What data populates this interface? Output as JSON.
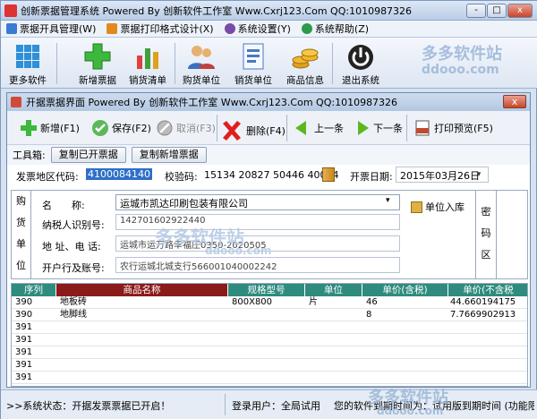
{
  "app": {
    "title": "创新票据管理系统 Powered By 创新软件工作室 Www.Cxrj123.Com QQ:1010987326",
    "min_glyph": "-",
    "max_glyph": "□",
    "close_glyph": "x"
  },
  "menubar": [
    {
      "label": "票据开具管理(W)",
      "color": "#3a7bd5"
    },
    {
      "label": "票据打印格式设计(X)",
      "color": "#e08a1e"
    },
    {
      "label": "系统设置(Y)",
      "color": "#7a4aa8"
    },
    {
      "label": "系统帮助(Z)",
      "color": "#2e9a4a"
    }
  ],
  "toolbar": {
    "more_software": "更多软件",
    "add_invoice": "新增票据",
    "sales_list": "销货清单",
    "buyer_unit": "购货单位",
    "seller_unit": "销货单位",
    "product_info": "商品信息",
    "exit_system": "退出系统"
  },
  "watermark": {
    "brand": "多多软件站",
    "url": "ddooo.com"
  },
  "invoice_window": {
    "title": "开据票据界面 Powered By 创新软件工作室 Www.Cxrj123.Com QQ:1010987326",
    "close_glyph": "x",
    "actions": {
      "add": "新增(F1)",
      "save": "保存(F2)",
      "cancel": "取消(F3)",
      "delete": "删除(F4)",
      "prev": "上一条",
      "next": "下一条",
      "print_preview": "打印预览(F5)"
    },
    "toolbox_label": "工具箱:",
    "copy_issued": "复制已开票据",
    "copy_new": "复制新增票据",
    "region_code_label": "发票地区代码:",
    "region_code": "4100084140",
    "check_code_label": "校验码:",
    "check_code": "15134 20827 50446 40034",
    "issue_date_label": "开票日期:",
    "issue_date": "2015年03月26日",
    "buyer": {
      "side_label": [
        "购",
        "货",
        "单",
        "位"
      ],
      "name_label": "名　　称:",
      "name_value": "运城市凯达印刷包装有限公司",
      "tax_id_label": "纳税人识别号:",
      "tax_id_value": "142701602922440",
      "address_label": "地 址、电 话:",
      "address_value": "运城市运万路幸福庄0350-2020505",
      "bank_label": "开户行及账号:",
      "bank_value": "农行运城北城支行566001040002242",
      "add_unit": "单位入库",
      "cipher_label": [
        "密",
        "码",
        "区"
      ]
    },
    "grid": {
      "columns": [
        "序列",
        "商品名称",
        "规格型号",
        "单位",
        "单价(含税)",
        "单价(不含税"
      ],
      "rows": [
        {
          "seq": "390",
          "name": "地板砖",
          "spec": "800X800",
          "unit": "片",
          "price_tax": "46",
          "price_notax": "44.660194175"
        },
        {
          "seq": "390",
          "name": "地脚线",
          "spec": "",
          "unit": "",
          "price_tax": "8",
          "price_notax": "7.7669902913"
        },
        {
          "seq": "391",
          "name": "",
          "spec": "",
          "unit": "",
          "price_tax": "",
          "price_notax": ""
        },
        {
          "seq": "391",
          "name": "",
          "spec": "",
          "unit": "",
          "price_tax": "",
          "price_notax": ""
        },
        {
          "seq": "391",
          "name": "",
          "spec": "",
          "unit": "",
          "price_tax": "",
          "price_notax": ""
        },
        {
          "seq": "391",
          "name": "",
          "spec": "",
          "unit": "",
          "price_tax": "",
          "price_notax": ""
        },
        {
          "seq": "391",
          "name": "",
          "spec": "",
          "unit": "",
          "price_tax": "",
          "price_notax": ""
        }
      ]
    }
  },
  "status": {
    "system_status": ">>系统状态：开据发票票据已开启！",
    "login_user": "登录用户：全局试用",
    "info": "您的软件到期时间为：试用版到期时间 (功能限制"
  }
}
